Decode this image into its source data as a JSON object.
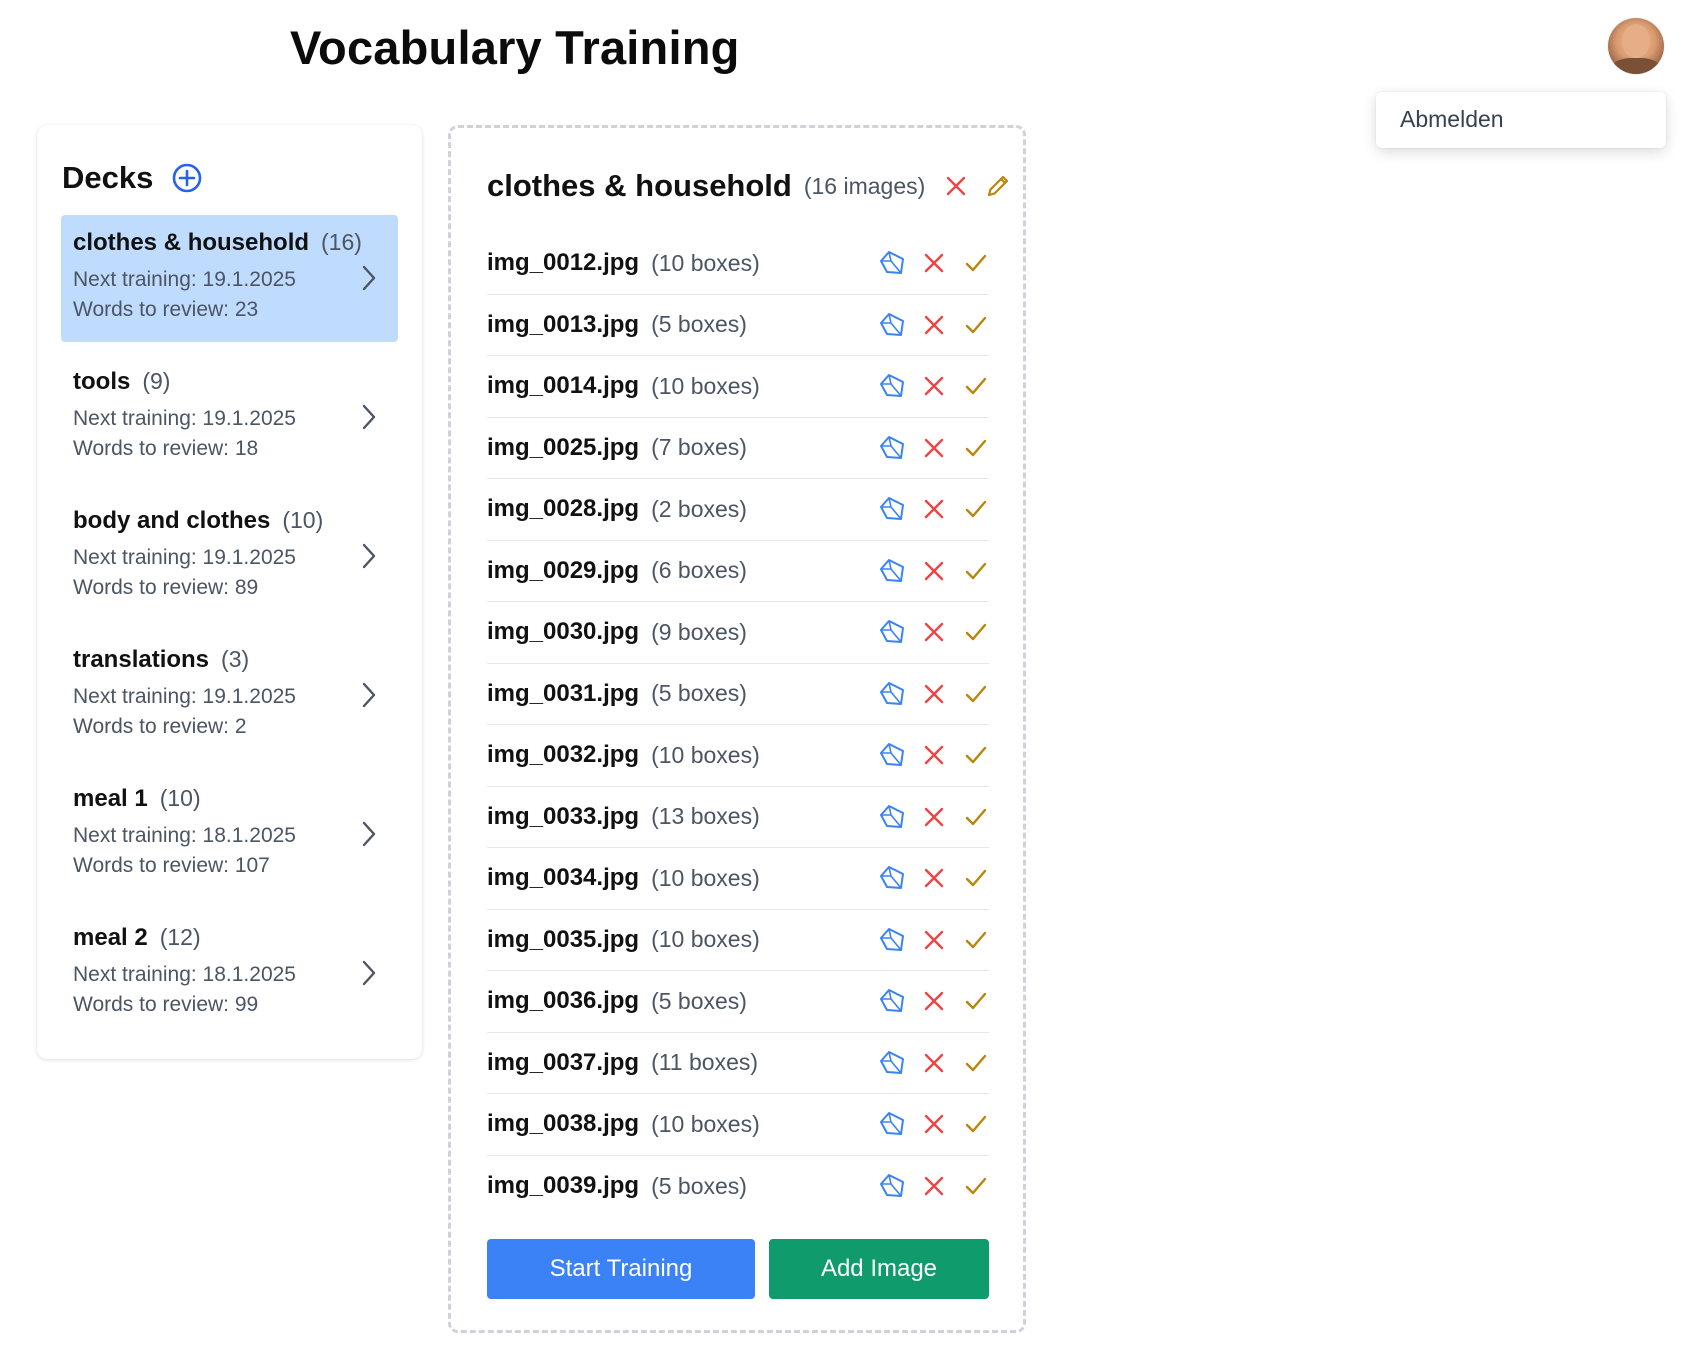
{
  "app": {
    "title": "Vocabulary Training"
  },
  "user_menu": {
    "logout_label": "Abmelden"
  },
  "decks_panel": {
    "title": "Decks",
    "active_index": 0,
    "items": [
      {
        "name": "clothes & household",
        "count": "(16)",
        "next_training": "Next training: 19.1.2025",
        "words_to_review": "Words to review: 23"
      },
      {
        "name": "tools",
        "count": "(9)",
        "next_training": "Next training: 19.1.2025",
        "words_to_review": "Words to review: 18"
      },
      {
        "name": "body and clothes",
        "count": "(10)",
        "next_training": "Next training: 19.1.2025",
        "words_to_review": "Words to review: 89"
      },
      {
        "name": "translations",
        "count": "(3)",
        "next_training": "Next training: 19.1.2025",
        "words_to_review": "Words to review: 2"
      },
      {
        "name": "meal 1",
        "count": "(10)",
        "next_training": "Next training: 18.1.2025",
        "words_to_review": "Words to review: 107"
      },
      {
        "name": "meal 2",
        "count": "(12)",
        "next_training": "Next training: 18.1.2025",
        "words_to_review": "Words to review: 99"
      }
    ]
  },
  "deck_detail": {
    "title": "clothes & household",
    "image_count": "(16 images)",
    "images": [
      {
        "name": "img_0012.jpg",
        "boxes": "(10 boxes)"
      },
      {
        "name": "img_0013.jpg",
        "boxes": "(5 boxes)"
      },
      {
        "name": "img_0014.jpg",
        "boxes": "(10 boxes)"
      },
      {
        "name": "img_0025.jpg",
        "boxes": "(7 boxes)"
      },
      {
        "name": "img_0028.jpg",
        "boxes": "(2 boxes)"
      },
      {
        "name": "img_0029.jpg",
        "boxes": "(6 boxes)"
      },
      {
        "name": "img_0030.jpg",
        "boxes": "(9 boxes)"
      },
      {
        "name": "img_0031.jpg",
        "boxes": "(5 boxes)"
      },
      {
        "name": "img_0032.jpg",
        "boxes": "(10 boxes)"
      },
      {
        "name": "img_0033.jpg",
        "boxes": "(13 boxes)"
      },
      {
        "name": "img_0034.jpg",
        "boxes": "(10 boxes)"
      },
      {
        "name": "img_0035.jpg",
        "boxes": "(10 boxes)"
      },
      {
        "name": "img_0036.jpg",
        "boxes": "(5 boxes)"
      },
      {
        "name": "img_0037.jpg",
        "boxes": "(11 boxes)"
      },
      {
        "name": "img_0038.jpg",
        "boxes": "(10 boxes)"
      },
      {
        "name": "img_0039.jpg",
        "boxes": "(5 boxes)"
      }
    ],
    "start_training_label": "Start Training",
    "add_image_label": "Add Image"
  },
  "icons": {
    "add_deck": "plus-circle-icon",
    "chevron": "chevron-right-icon",
    "delete": "x-icon",
    "edit": "pencil-icon",
    "annotate": "polygon-icon",
    "done": "check-icon"
  },
  "colors": {
    "primary_blue": "#3b82f6",
    "active_deck_bg": "#bfdbfe",
    "add_green": "#109b6c",
    "delete_red": "#ef4444",
    "check_amber": "#b8860b",
    "polygon_blue": "#3b82f6"
  }
}
